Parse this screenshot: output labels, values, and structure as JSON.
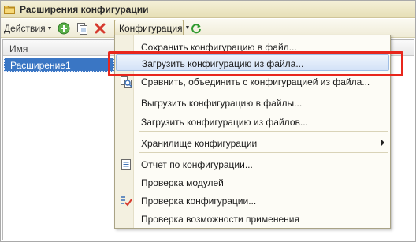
{
  "window": {
    "title": "Расширения конфигурации",
    "title_icon": "folder-icon"
  },
  "toolbar": {
    "actions_label": "Действия",
    "configuration_label": "Конфигурация",
    "icons": [
      "add-icon",
      "copy-icon",
      "delete-icon",
      "refresh-icon"
    ]
  },
  "table": {
    "columns": [
      "Имя"
    ],
    "rows": [
      {
        "name": "Расширение1",
        "selected": true
      }
    ]
  },
  "menu": {
    "items": [
      {
        "label": "Сохранить конфигурацию в файл...",
        "icon": ""
      },
      {
        "label": "Загрузить конфигурацию из файла...",
        "icon": "",
        "highlighted": true
      },
      {
        "label": "Сравнить, объединить с конфигурацией из файла...",
        "icon": "compare-icon"
      },
      {
        "label": "Выгрузить конфигурацию в файлы...",
        "icon": ""
      },
      {
        "label": "Загрузить конфигурацию из файлов...",
        "icon": ""
      },
      {
        "label": "Хранилище конфигурации",
        "icon": "",
        "submenu": true
      },
      {
        "label": "Отчет по конфигурации...",
        "icon": "report-icon"
      },
      {
        "label": "Проверка модулей",
        "icon": ""
      },
      {
        "label": "Проверка конфигурации...",
        "icon": "check-icon"
      },
      {
        "label": "Проверка возможности применения",
        "icon": ""
      }
    ]
  },
  "colors": {
    "selection": "#3a76c4",
    "highlight_box": "#e8261c",
    "title_bar": "#e6dfb6"
  }
}
